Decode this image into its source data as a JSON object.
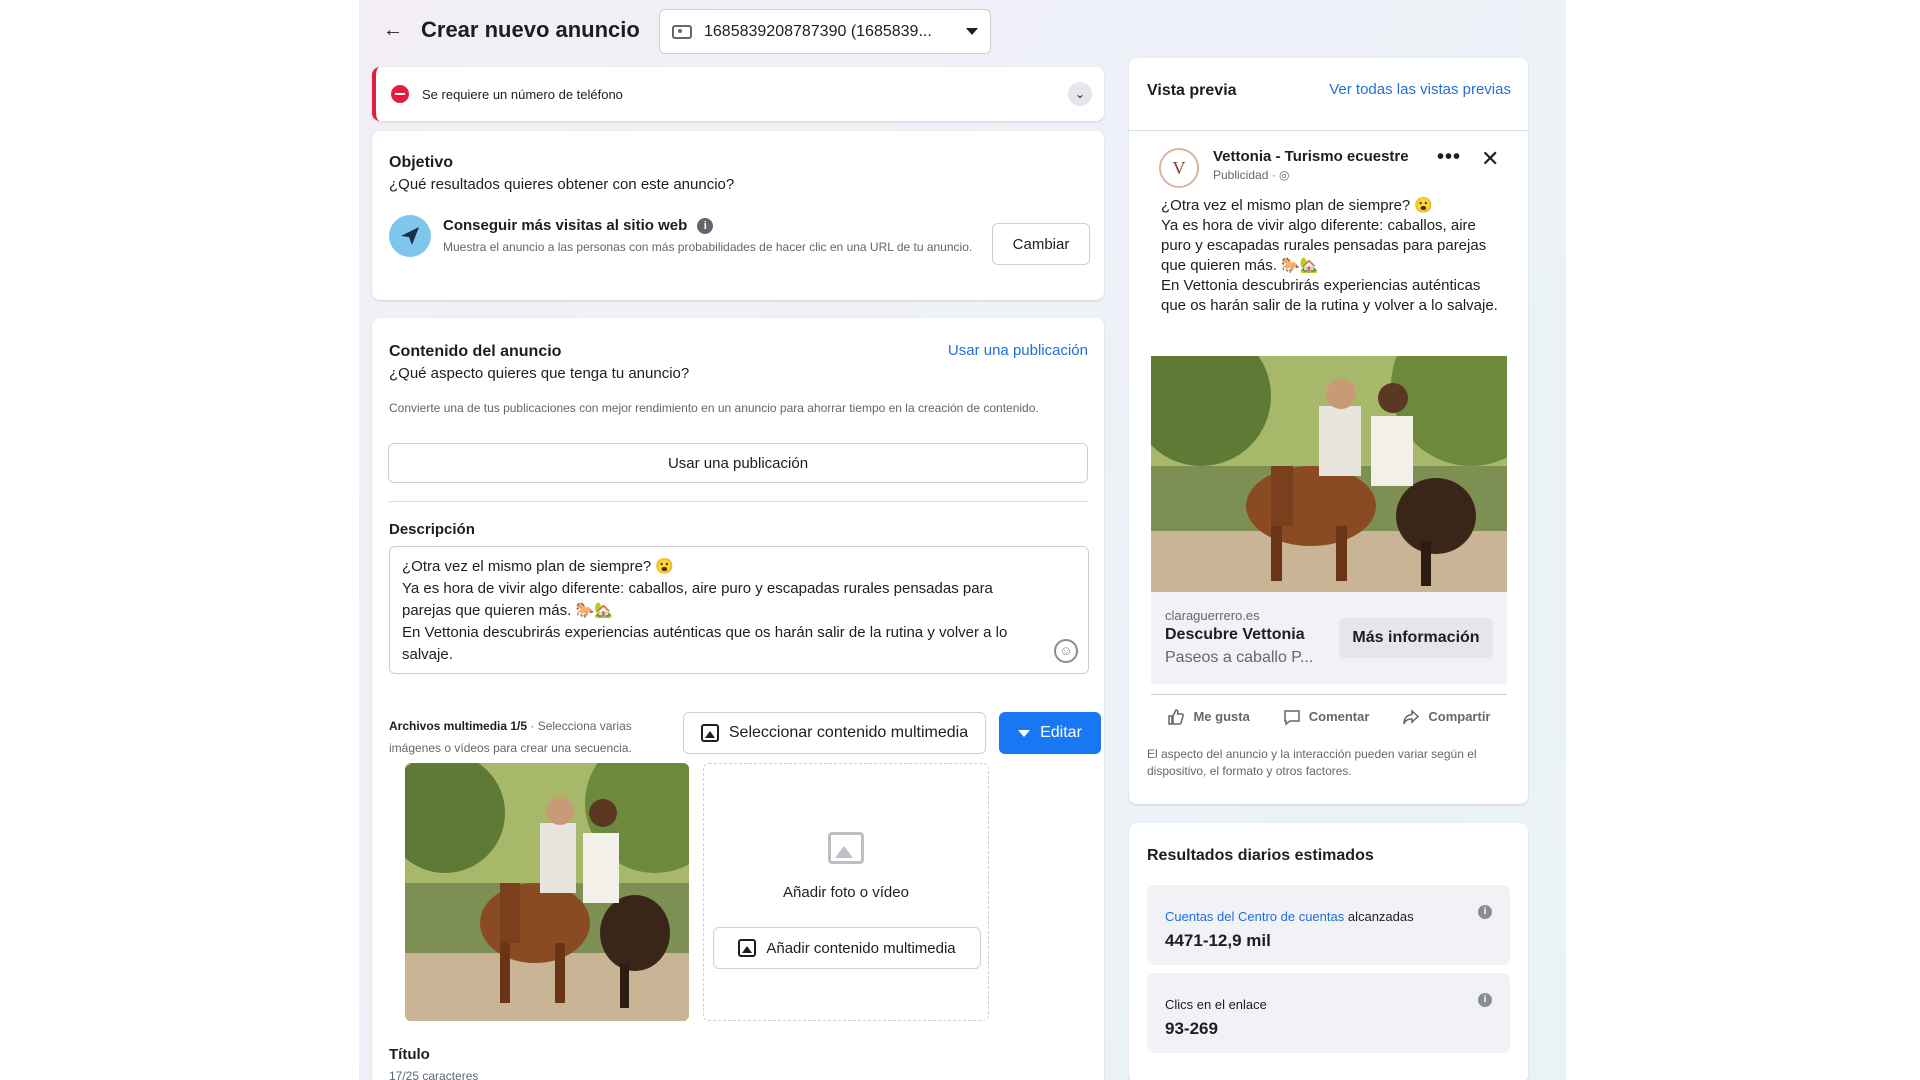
{
  "header": {
    "title": "Crear nuevo anuncio",
    "account_selector": "1685839208787390 (1685839..."
  },
  "alert": {
    "message": "Se requiere un número de teléfono"
  },
  "objective": {
    "heading": "Objetivo",
    "question": "¿Qué resultados quieres obtener con este anuncio?",
    "option_title": "Conseguir más visitas al sitio web",
    "option_desc": "Muestra el anuncio a las personas con más probabilidades de hacer clic en una URL de tu anuncio.",
    "change_button": "Cambiar"
  },
  "ad_content": {
    "heading": "Contenido del anuncio",
    "use_post_link": "Usar una publicación",
    "question": "¿Qué aspecto quieres que tenga tu anuncio?",
    "hint": "Convierte una de tus publicaciones con mejor rendimiento en un anuncio para ahorrar tiempo en la creación de contenido.",
    "use_post_button": "Usar una publicación",
    "description_label": "Descripción",
    "description_lines": [
      "¿Otra vez el mismo plan de siempre? 😮",
      "Ya es hora de vivir algo diferente: caballos, aire puro y escapadas rurales pensadas para",
      "parejas que quieren más. 🐎🏡",
      "En Vettonia descubrirás experiencias auténticas que os harán salir de la rutina y volver a lo",
      "salvaje."
    ],
    "media_label_bold": "Archivos multimedia 1/5",
    "media_label_rest": " · Selecciona varias imágenes o vídeos para crear una secuencia.",
    "select_media_button": "Seleccionar contenido multimedia",
    "edit_button": "Editar",
    "add_photo_label": "Añadir foto o vídeo",
    "add_media_button": "Añadir contenido multimedia",
    "title_label": "Título",
    "title_chars": "17/25 caracteres"
  },
  "preview": {
    "heading": "Vista previa",
    "see_all_link": "Ver todas las vistas previas",
    "page_name": "Vettonia - Turismo ecuestre",
    "sponsored": "Publicidad · ◎",
    "avatar_letter": "V",
    "text_lines": [
      "¿Otra vez el mismo plan de siempre? 😮",
      "Ya es hora de vivir algo diferente: caballos, aire puro y escapadas rurales pensadas para parejas que quieren más. 🐎🏡",
      "En Vettonia descubrirás experiencias auténticas que os harán salir de la rutina y volver a lo salvaje."
    ],
    "domain": "claraguerrero.es",
    "headline": "Descubre Vettonia",
    "link_description": "Paseos a caballo P...",
    "cta": "Más información",
    "actions": [
      "Me gusta",
      "Comentar",
      "Compartir"
    ],
    "disclaimer": "El aspecto del anuncio y la interacción pueden variar según el dispositivo, el formato y otros factores."
  },
  "results": {
    "heading": "Resultados diarios estimados",
    "metrics": [
      {
        "label_link": "Cuentas del Centro de cuentas",
        "label_rest": " alcanzadas",
        "value": "4471-12,9 mil"
      },
      {
        "label_link": "",
        "label_rest": "Clics en el enlace",
        "value": "93-269"
      }
    ]
  },
  "colors": {
    "accent": "#1877f2",
    "link": "#216fdb",
    "error": "#e41e3f"
  },
  "icons": [
    "back-arrow-icon",
    "ad-account-icon",
    "error-icon",
    "chevron-down-icon",
    "cursor-icon",
    "info-icon",
    "media-icon",
    "photo-placeholder-icon",
    "more-icon",
    "close-icon",
    "like-icon",
    "comment-icon",
    "share-icon"
  ]
}
